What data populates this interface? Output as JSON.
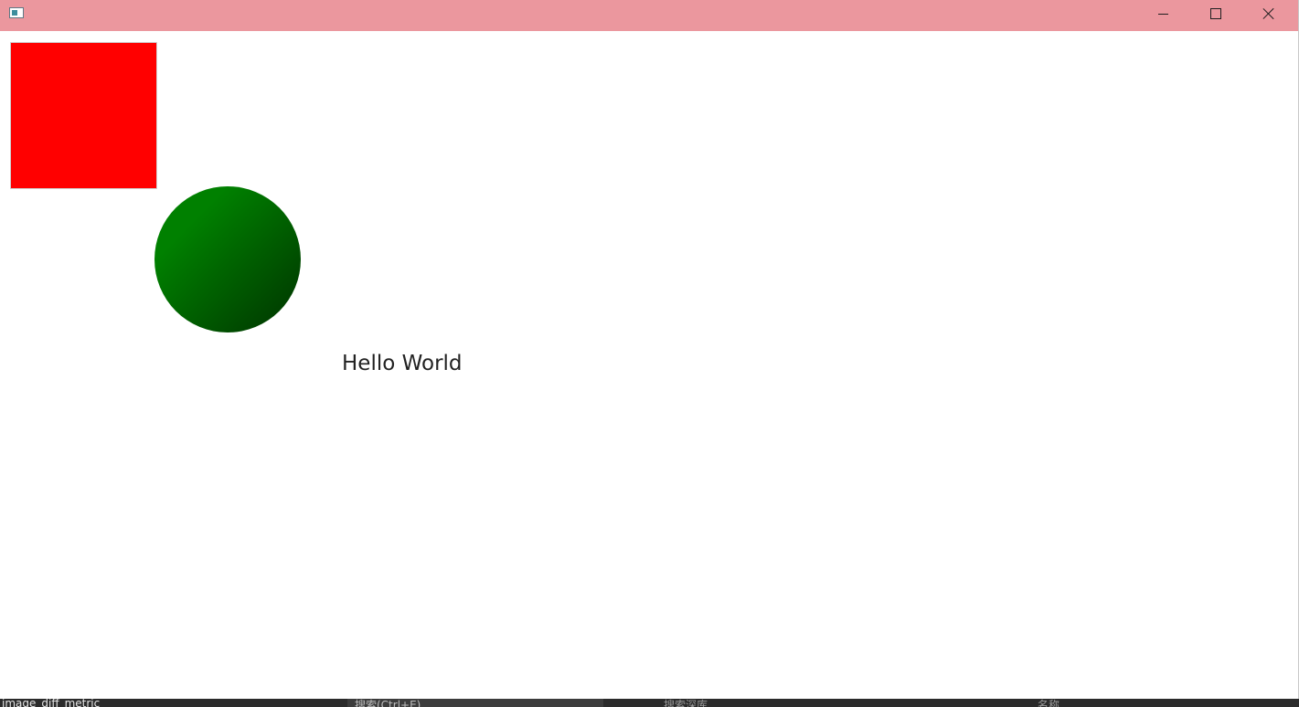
{
  "window": {
    "title": "",
    "titlebar_color": "#EB979E",
    "buttons": {
      "minimize_icon": "minimize-icon",
      "maximize_icon": "maximize-icon",
      "close_icon": "close-icon"
    }
  },
  "canvas": {
    "square": {
      "fill": "#FF0000"
    },
    "circle": {
      "gradient_start": "#008000",
      "gradient_end": "#003300"
    },
    "text": "Hello World"
  },
  "taskbar": {
    "left_label": "image_diff_metric",
    "search_placeholder": "搜索(Ctrl+E)",
    "repo_label": "搜索深库",
    "name_label": "名称"
  }
}
